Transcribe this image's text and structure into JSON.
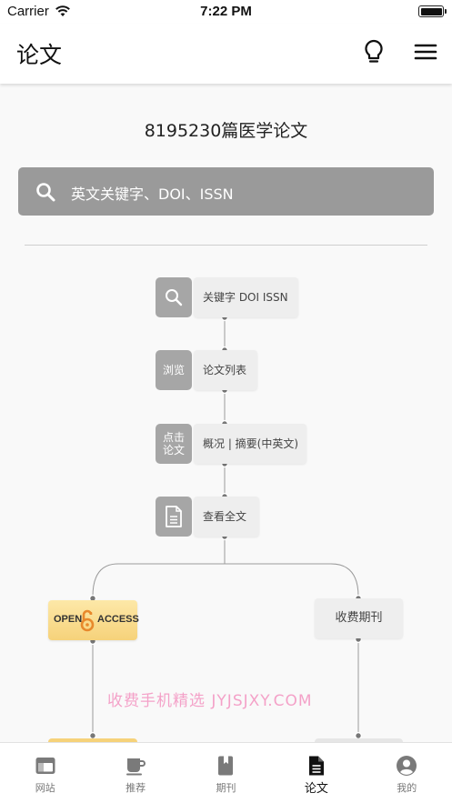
{
  "status_bar": {
    "carrier": "Carrier",
    "time": "7:22 PM"
  },
  "nav": {
    "title": "论文",
    "icons": [
      "lightbulb-icon",
      "menu-icon"
    ]
  },
  "main": {
    "headline": "8195230篇医学论文",
    "search": {
      "placeholder": "英文关键字、DOI、ISSN",
      "icon": "search-icon"
    },
    "flow": {
      "steps": [
        {
          "icon": "search-icon",
          "icon_text": "",
          "label": "关键字  DOI ISSN"
        },
        {
          "icon": "text",
          "icon_text": "浏览",
          "label": "论文列表"
        },
        {
          "icon": "text",
          "icon_text": "点击\n论文",
          "label": "概况 | 摘要(中英文)"
        },
        {
          "icon": "document-icon",
          "icon_text": "",
          "label": "查看全文"
        }
      ],
      "open_access": {
        "left": "OPEN",
        "right": "ACCESS"
      },
      "paid_journal": "收费期刊"
    }
  },
  "watermark": "收费手机精选 JYJSJXY.COM",
  "tab_bar": {
    "active": "论文",
    "tabs": [
      {
        "label": "网站",
        "icon": "browser-window-icon"
      },
      {
        "label": "推荐",
        "icon": "coffee-cup-icon"
      },
      {
        "label": "期刊",
        "icon": "book-icon"
      },
      {
        "label": "论文",
        "icon": "document-icon"
      },
      {
        "label": "我的",
        "icon": "user-avatar-icon"
      }
    ]
  },
  "colors": {
    "search_bg": "#9a9a9a",
    "icon_box_bg": "#a6a6a6",
    "label_box_bg": "#eeeeee",
    "open_access_bg": "#f6d27a",
    "open_access_lock": "#e8892c"
  }
}
